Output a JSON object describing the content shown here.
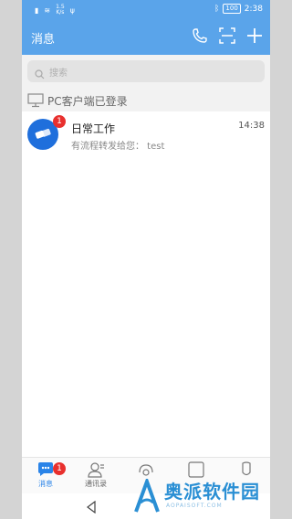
{
  "status_bar": {
    "speed_top": "1.5",
    "speed_unit": "K/s",
    "battery": "100",
    "time": "2:38"
  },
  "header": {
    "title": "消息",
    "icons": [
      "phone-icon",
      "scan-icon",
      "add-icon"
    ]
  },
  "search": {
    "placeholder": "搜索"
  },
  "pc_notice": "PC客户端已登录",
  "chats": [
    {
      "name": "日常工作",
      "preview": "有流程转发给您： test",
      "time": "14:38",
      "badge": "1"
    }
  ],
  "tabs": [
    {
      "label": "消息",
      "badge": "1",
      "icon": "message-icon",
      "active": true
    },
    {
      "label": "通讯录",
      "icon": "contacts-icon"
    },
    {
      "label": "",
      "icon": "workbench-icon"
    },
    {
      "label": "",
      "icon": "app-icon"
    },
    {
      "label": "",
      "icon": "me-icon"
    }
  ],
  "watermark": {
    "text": "奥派软件园",
    "url": "AOPAISOFT.COM"
  },
  "colors": {
    "header": "#5aa4ea",
    "accent": "#2a84e8",
    "badge": "#e8302e",
    "avatar": "#1f6fdc"
  }
}
